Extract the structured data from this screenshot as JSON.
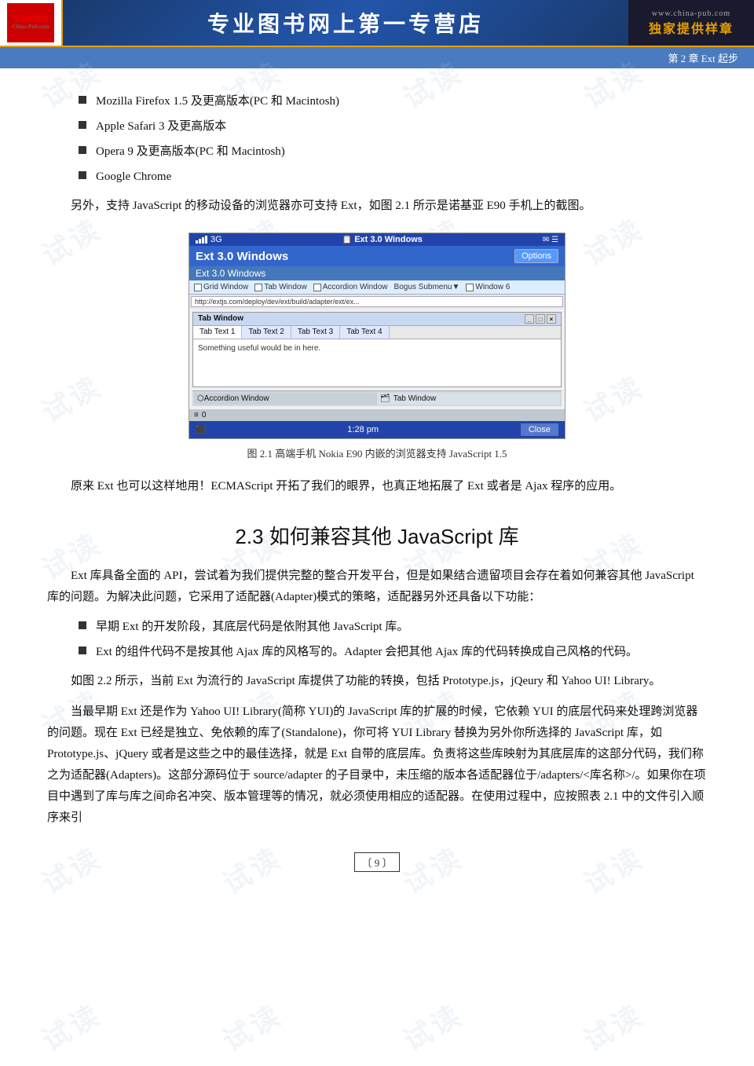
{
  "header": {
    "logo_line1": "互动出版网",
    "logo_line2": "China-Pub.com",
    "title": "专业图书网上第一专营店",
    "website": "www.china-pub.com",
    "exclusive": "独家提供样章"
  },
  "chapter_bar": {
    "text": "第 2 章   Ext 起步"
  },
  "watermarks": [
    "试读",
    "试读",
    "试读",
    "试读",
    "试读",
    "试读",
    "试读",
    "试读",
    "试读"
  ],
  "bullet_items": [
    "Mozilla Firefox 1.5 及更高版本(PC 和 Macintosh)",
    "Apple Safari 3 及更高版本",
    "Opera 9 及更高版本(PC 和 Macintosh)",
    "Google Chrome"
  ],
  "intro_para": "另外，支持 JavaScript 的移动设备的浏览器亦可支持 Ext，如图 2.1 所示是诺基亚 E90 手机上的截图。",
  "figure": {
    "phone_app_title": "Ext 3.0 Windows",
    "options_btn": "Options",
    "menu_items": [
      "Grid Window",
      "Tab Window",
      "Accordion Window",
      "Bogus Submenu▼",
      "Window 6"
    ],
    "inner_window_title": "Tab Window",
    "tabs": [
      "Tab Text 1",
      "Tab Text 2",
      "Tab Text 3",
      "Tab Text 4"
    ],
    "tab_content": "Something useful would be in here.",
    "accordion_label": "Accordion Window",
    "tab_window_label": "Tab Window",
    "time": "1:28 pm",
    "close_btn": "Close",
    "status_left": "3G",
    "app_title_full": "Ext 3.0 Windows",
    "url": "http://extjs.com/deploy/dev/ext/build/adapter/ext/ex...",
    "caption": "图 2.1   高端手机 Nokia E90 内嵌的浏览器支持 JavaScript 1.5"
  },
  "para2": "原来 Ext 也可以这样地用！ECMAScript 开拓了我们的眼界，也真正地拓展了 Ext 或者是 Ajax 程序的应用。",
  "section_title": "2.3   如何兼容其他 JavaScript 库",
  "para3": "Ext 库具备全面的 API，尝试着为我们提供完整的整合开发平台，但是如果结合遗留项目会存在着如何兼容其他 JavaScript 库的问题。为解决此问题，它采用了适配器(Adapter)模式的策略，适配器另外还具备以下功能：",
  "bullet2_items": [
    "早期 Ext 的开发阶段，其底层代码是依附其他 JavaScript 库。",
    "Ext 的组件代码不是按其他 Ajax 库的风格写的。Adapter 会把其他 Ajax 库的代码转换成自己风格的代码。"
  ],
  "para4": "如图 2.2 所示，当前 Ext 为流行的 JavaScript 库提供了功能的转换，包括 Prototype.js，jQeury 和 Yahoo UI! Library。",
  "para5": "当最早期 Ext 还是作为 Yahoo UI! Library(简称 YUI)的 JavaScript 库的扩展的时候，它依赖 YUI 的底层代码来处理跨浏览器的问题。现在 Ext 已经是独立、免依赖的库了(Standalone)，你可将 YUI  Library 替换为另外你所选择的 JavaScript 库，如 Prototype.js、jQuery 或者是这些之中的最佳选择，就是 Ext 自带的底层库。负责将这些库映射为其底层库的这部分代码，我们称之为适配器(Adapters)。这部分源码位于 source/adapter 的子目录中，未压缩的版本各适配器位于/adapters/<库名称>/。如果你在项目中遇到了库与库之间命名冲突、版本管理等的情况，就必须使用相应的适配器。在使用过程中，应按照表 2.1 中的文件引入顺序来引",
  "page_number": "9"
}
